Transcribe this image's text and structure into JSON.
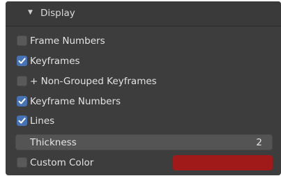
{
  "panel": {
    "title": "Display",
    "options": [
      {
        "label": "Frame Numbers",
        "checked": false
      },
      {
        "label": "Keyframes",
        "checked": true
      },
      {
        "label": "+ Non-Grouped Keyframes",
        "checked": false
      },
      {
        "label": "Keyframe Numbers",
        "checked": true
      },
      {
        "label": "Lines",
        "checked": true
      }
    ],
    "thickness": {
      "label": "Thickness",
      "value": "2"
    },
    "custom_color": {
      "label": "Custom Color",
      "checked": false,
      "color": "#a01a1a"
    }
  },
  "colors": {
    "panel_bg": "#3d3d3d",
    "checkbox_on": "#4772b3",
    "checkbox_off": "#595959"
  }
}
